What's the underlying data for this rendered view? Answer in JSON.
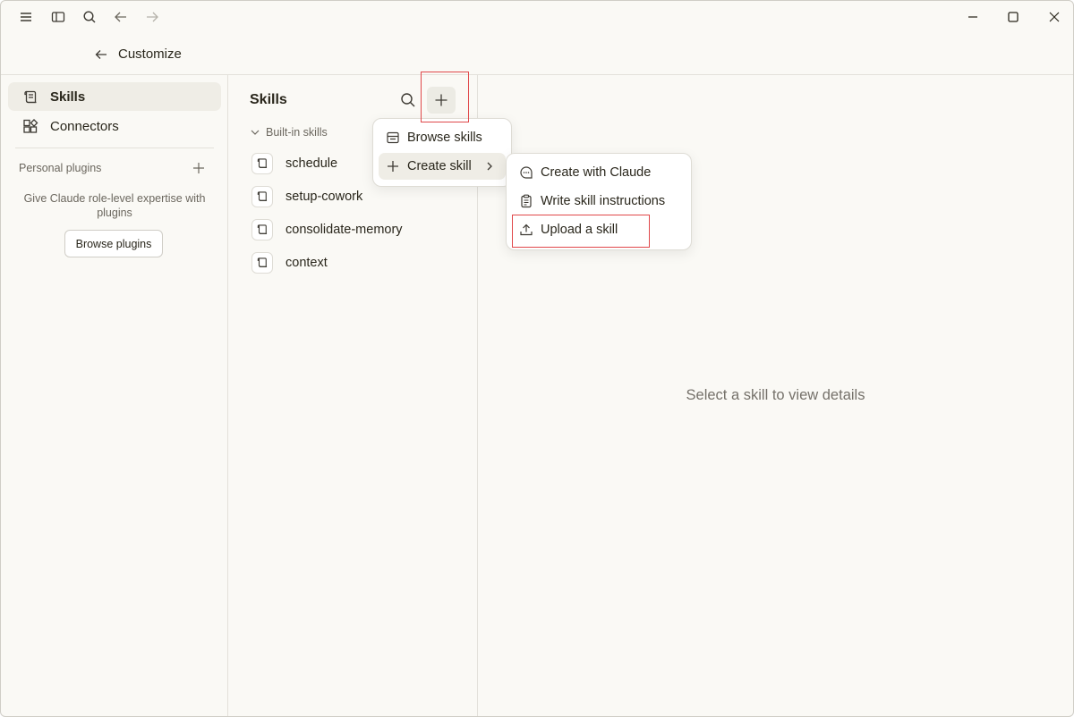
{
  "header": {
    "title": "Customize"
  },
  "sidebar": {
    "items": [
      {
        "label": "Skills",
        "icon": "scroll-icon",
        "active": true
      },
      {
        "label": "Connectors",
        "icon": "connectors-icon",
        "active": false
      }
    ],
    "personal_plugins_label": "Personal plugins",
    "plugins_description": "Give Claude role-level expertise with plugins",
    "browse_plugins_label": "Browse plugins"
  },
  "skills_panel": {
    "title": "Skills",
    "group_label": "Built-in skills",
    "skills": [
      "schedule",
      "setup-cowork",
      "consolidate-memory",
      "context"
    ]
  },
  "add_menu": {
    "items": [
      {
        "label": "Browse skills",
        "icon": "store-icon"
      },
      {
        "label": "Create skill",
        "icon": "plus-icon"
      }
    ]
  },
  "create_submenu": {
    "items": [
      {
        "label": "Create with Claude",
        "icon": "chat-bubble-icon"
      },
      {
        "label": "Write skill instructions",
        "icon": "clipboard-icon"
      },
      {
        "label": "Upload a skill",
        "icon": "upload-icon"
      }
    ]
  },
  "detail": {
    "empty_message": "Select a skill to view details"
  },
  "colors": {
    "background": "#faf9f5",
    "highlight_box": "#e0484a",
    "active_item": "#efede6"
  }
}
